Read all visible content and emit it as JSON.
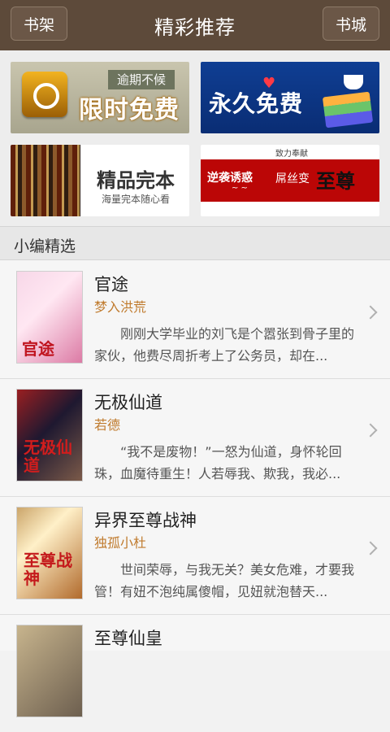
{
  "app": {
    "title": "精彩推荐",
    "left_button": "书架",
    "right_button": "书城"
  },
  "banners": [
    {
      "main": "限时免费",
      "sub": "逾期不候"
    },
    {
      "main": "永久免费"
    },
    {
      "main": "精品完本",
      "sub": "海量完本随心看"
    },
    {
      "main": "至尊",
      "left": "逆袭诱惑",
      "right": "屌丝变",
      "top": "致力奉献"
    }
  ],
  "section": {
    "title": "小编精选"
  },
  "books": [
    {
      "title": "官途",
      "author": "梦入洪荒",
      "desc": "刚刚大学毕业的刘飞是个嚣张到骨子里的家伙，他费尽周折考上了公务员，却在...",
      "cover_text": "官途"
    },
    {
      "title": "无极仙道",
      "author": "若德",
      "desc": "“我不是废物！”一怒为仙道，身怀轮回珠，血魔待重生！人若辱我、欺我，我必...",
      "cover_text": "无极仙道"
    },
    {
      "title": "异界至尊战神",
      "author": "独孤小杜",
      "desc": "世间荣辱，与我无关？美女危难，才要我管！有妞不泡纯属傻帽，见妞就泡替天...",
      "cover_text": "至尊战神"
    },
    {
      "title": "至尊仙皇"
    }
  ]
}
